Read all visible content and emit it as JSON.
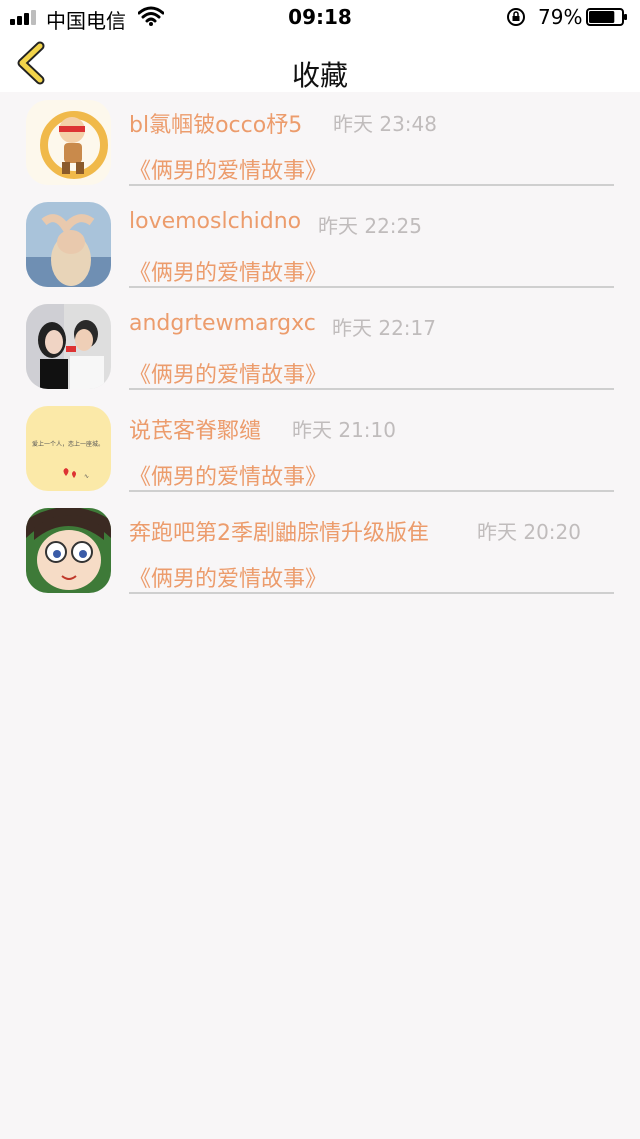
{
  "status": {
    "carrier": "中国电信",
    "time": "09:18",
    "battery_pct": "79%",
    "battery_level": 0.79
  },
  "nav": {
    "title": "收藏",
    "back_icon": "chevron-left-icon"
  },
  "colors": {
    "accent": "#ec9c6c",
    "time_gray": "#c0bcbc",
    "divider": "#cfcfcf",
    "back": "#f2d44a"
  },
  "favorites": [
    {
      "name": "bl氯帼铍occo杼5",
      "time": "昨天 23:48",
      "book": "《俩男的爱情故事》",
      "avatar": "cartoon-avatar"
    },
    {
      "name": "lovemoslchidno",
      "time": "昨天 22:25",
      "book": "《俩男的爱情故事》",
      "avatar": "photo-avatar"
    },
    {
      "name": "andgrtewmargxc",
      "time": "昨天 22:17",
      "book": "《俩男的爱情故事》",
      "avatar": "photo-avatar"
    },
    {
      "name": "说芪客脊鄹缱",
      "time": "昨天 21:10",
      "book": "《俩男的爱情故事》",
      "avatar": "text-card-avatar",
      "avatar_text": "爱上一个人，恋上一座城。"
    },
    {
      "name": "奔跑吧第2季剧鼬腙情升级版隹",
      "time": "昨天 20:20",
      "book": "《俩男的爱情故事》",
      "avatar": "anime-avatar"
    }
  ]
}
